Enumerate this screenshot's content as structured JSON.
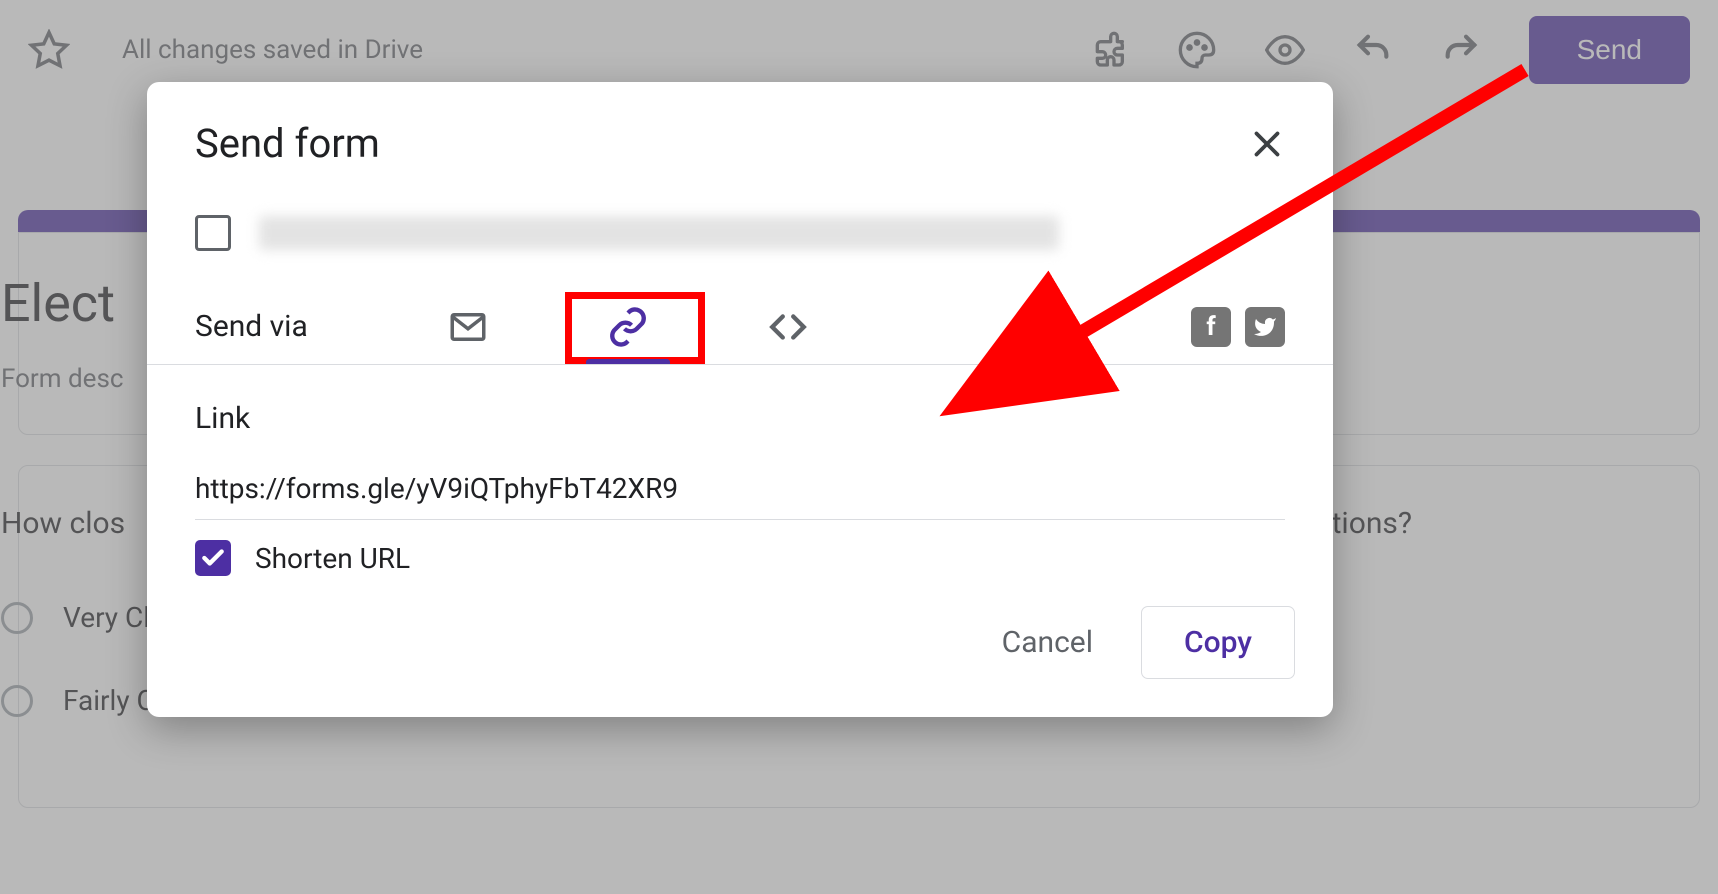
{
  "topbar": {
    "save_status": "All changes saved in Drive",
    "send_label": "Send"
  },
  "form": {
    "title_visible": "Elect",
    "description_visible": "Form desc",
    "question_visible_left": "How clos",
    "question_visible_right": "ections?",
    "options": [
      "Very Closely",
      "Fairly Closely"
    ]
  },
  "dialog": {
    "title": "Send form",
    "send_via_label": "Send via",
    "link_section_title": "Link",
    "link_value": "https://forms.gle/yV9iQTphyFbT42XR9",
    "shorten_label": "Shorten URL",
    "shorten_checked": true,
    "cancel_label": "Cancel",
    "copy_label": "Copy"
  }
}
